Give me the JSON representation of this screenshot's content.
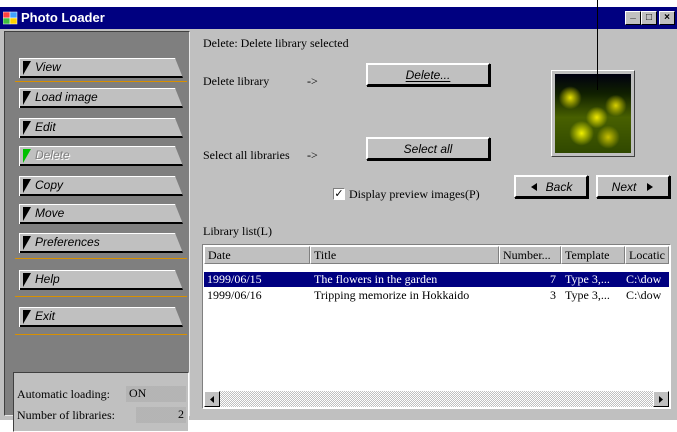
{
  "window": {
    "title": "Photo Loader",
    "controls": {
      "minimize": "_",
      "maximize": "□",
      "close": "×"
    }
  },
  "nav": {
    "items": [
      {
        "label": "View",
        "state": "normal"
      },
      {
        "label": "Load image",
        "state": "normal"
      },
      {
        "label": "Edit",
        "state": "normal"
      },
      {
        "label": "Delete",
        "state": "disabled-active"
      },
      {
        "label": "Copy",
        "state": "normal"
      },
      {
        "label": "Move",
        "state": "normal"
      },
      {
        "label": "Preferences",
        "state": "normal"
      },
      {
        "label": "Help",
        "state": "normal"
      },
      {
        "label": "Exit",
        "state": "normal"
      }
    ]
  },
  "status": {
    "auto_loading_label": "Automatic loading:",
    "auto_loading_value": "ON",
    "num_libraries_label": "Number of libraries:",
    "num_libraries_value": "2"
  },
  "content": {
    "status_line": "Delete: Delete library selected",
    "delete_library_label": "Delete library",
    "arrow": "->",
    "delete_button": "Delete...",
    "select_all_label": "Select all libraries",
    "select_all_button": "Select all",
    "display_preview_label": "Display preview images(P)",
    "display_preview_checked": true,
    "checkmark": "✓",
    "back_button": "Back",
    "next_button": "Next",
    "library_list_label": "Library list(L)"
  },
  "list": {
    "columns": [
      "Date",
      "Title",
      "Number...",
      "Template",
      "Locatic"
    ],
    "rows": [
      {
        "date": "1999/06/15",
        "title": "The flowers in the garden",
        "number": "7",
        "template": "Type 3,...",
        "location": "C:\\dow",
        "selected": true
      },
      {
        "date": "1999/06/16",
        "title": "Tripping memorize in Hokkaido",
        "number": "3",
        "template": "Type 3,...",
        "location": "C:\\dow",
        "selected": false
      }
    ]
  },
  "colors": {
    "titlebar": "#000080",
    "selection": "#000080",
    "face": "#c0c0c0",
    "separator": "#d89000",
    "active_indicator": "#00c000"
  },
  "icons": {
    "app": "photo-loader-icon",
    "back": "left-triangle-icon",
    "next": "right-triangle-icon",
    "scroll_left": "left-triangle-icon",
    "scroll_right": "right-triangle-icon"
  }
}
